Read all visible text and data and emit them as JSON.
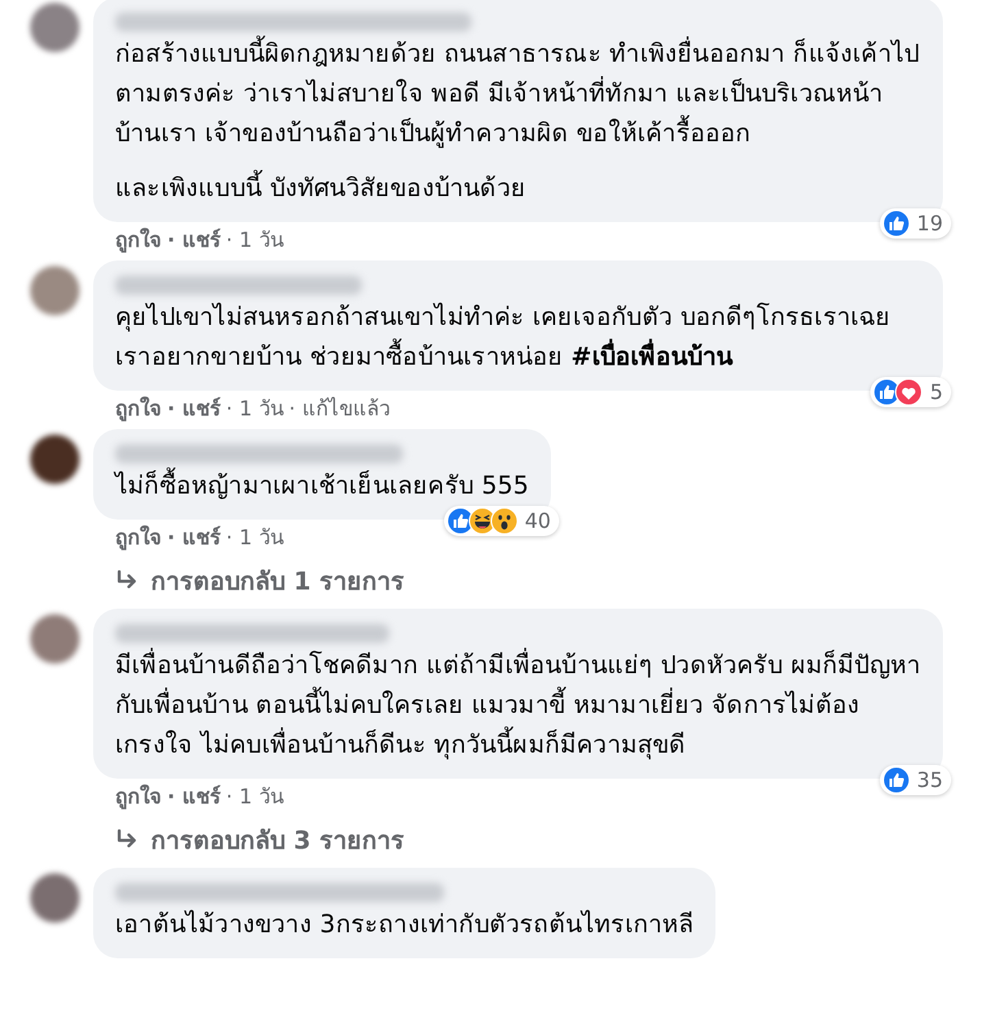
{
  "comments": [
    {
      "paragraphs": [
        "ก่อสร้างแบบนี้ผิดกฎหมายด้วย ถนนสาธารณะ ทำเพิงยื่นออกมา ก็แจ้งเค้าไปตามตรงค่ะ ว่าเราไม่สบายใจ พอดี มีเจ้าหน้าที่ทักมา และเป็นบริเวณหน้าบ้านเรา เจ้าของบ้านถือว่าเป็นผู้ทำความผิด ขอให้เค้ารื้อออก",
        "และเพิงแบบนี้ บังทัศนวิสัยของบ้านด้วย"
      ],
      "reactions": [
        {
          "kind": "like"
        }
      ],
      "reaction_count": "19",
      "actions": [
        "ถูกใจ",
        "· แชร์",
        "· 1 วัน"
      ]
    },
    {
      "paragraphs": [
        "คุยไปเขาไม่สนหรอกถ้าสนเขาไม่ทำค่ะ เคยเจอกับตัว บอกดีๆโกรธเราเฉย เราอยากขายบ้าน ช่วยมาซื้อบ้านเราหน่อย **#เบื่อเพื่อนบ้าน**"
      ],
      "reactions": [
        {
          "kind": "like"
        },
        {
          "kind": "love"
        }
      ],
      "reaction_count": "5",
      "actions": [
        "ถูกใจ",
        "· แชร์",
        "· 1 วัน",
        "· แก้ไขแล้ว"
      ]
    },
    {
      "paragraphs": [
        "ไม่ก็ซื้อหญ้ามาเผาเช้าเย็นเลยครับ 555"
      ],
      "reactions": [
        {
          "kind": "like"
        },
        {
          "kind": "haha"
        },
        {
          "kind": "wow"
        }
      ],
      "reaction_count": "40",
      "actions": [
        "ถูกใจ",
        "· แชร์",
        "· 1 วัน"
      ],
      "replies": "การตอบกลับ 1 รายการ"
    },
    {
      "paragraphs": [
        "มีเพื่อนบ้านดีถือว่าโชคดีมาก แต่ถ้ามีเพื่อนบ้านแย่ๆ ปวดหัวครับ ผมก็มีปัญหากับเพื่อนบ้าน ตอนนี้ไม่คบใครเลย แมวมาขี้ หมามาเยี่ยว จัดการไม่ต้องเกรงใจ ไม่คบเพื่อนบ้านก็ดีนะ ทุกวันนี้ผมก็มีความสุขดี"
      ],
      "reactions": [
        {
          "kind": "like"
        }
      ],
      "reaction_count": "35",
      "actions": [
        "ถูกใจ",
        "· แชร์",
        "· 1 วัน"
      ],
      "replies": "การตอบกลับ 3 รายการ"
    },
    {
      "paragraphs": [
        "เอาต้นไม้วางขวาง 3กระถางเท่ากับตัวรถต้นไทรเกาหลี"
      ]
    }
  ]
}
